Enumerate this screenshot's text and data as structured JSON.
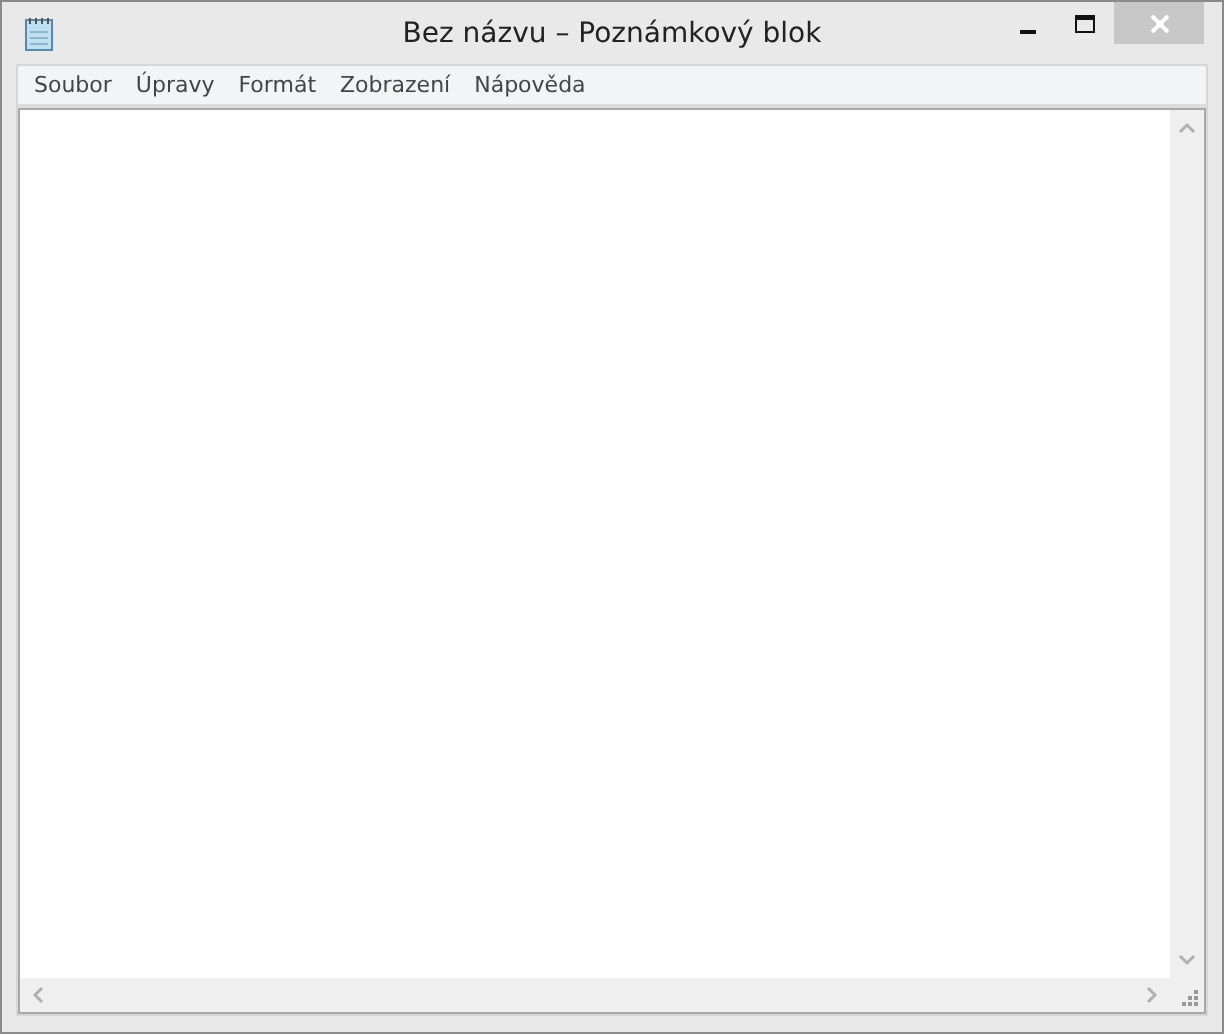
{
  "window": {
    "title": "Bez názvu – Poznámkový blok"
  },
  "menu": [
    {
      "label": "Soubor"
    },
    {
      "label": "Úpravy"
    },
    {
      "label": "Formát"
    },
    {
      "label": "Zobrazení"
    },
    {
      "label": "Nápověda"
    }
  ]
}
